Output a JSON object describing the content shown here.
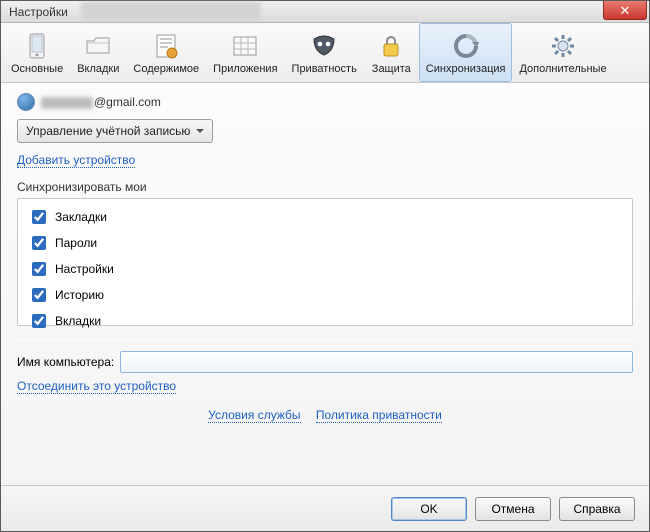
{
  "window": {
    "title": "Настройки"
  },
  "tabs": {
    "general": {
      "label": "Основные"
    },
    "tabs": {
      "label": "Вкладки"
    },
    "content": {
      "label": "Содержимое"
    },
    "apps": {
      "label": "Приложения"
    },
    "privacy": {
      "label": "Приватность"
    },
    "security": {
      "label": "Защита"
    },
    "sync": {
      "label": "Синхронизация"
    },
    "advanced": {
      "label": "Дополнительные"
    }
  },
  "account": {
    "email_domain": "@gmail.com",
    "manage_label": "Управление учётной записью",
    "add_device": "Добавить устройство"
  },
  "sync": {
    "header": "Синхронизировать мои",
    "items": [
      {
        "label": "Закладки",
        "checked": true
      },
      {
        "label": "Пароли",
        "checked": true
      },
      {
        "label": "Настройки",
        "checked": true
      },
      {
        "label": "Историю",
        "checked": true
      },
      {
        "label": "Вкладки",
        "checked": true
      }
    ]
  },
  "computer": {
    "label": "Имя компьютера:",
    "value": "",
    "unlink": "Отсоединить это устройство"
  },
  "legal": {
    "tos": "Условия службы",
    "privacy": "Политика приватности"
  },
  "buttons": {
    "ok": "OK",
    "cancel": "Отмена",
    "help": "Справка"
  }
}
